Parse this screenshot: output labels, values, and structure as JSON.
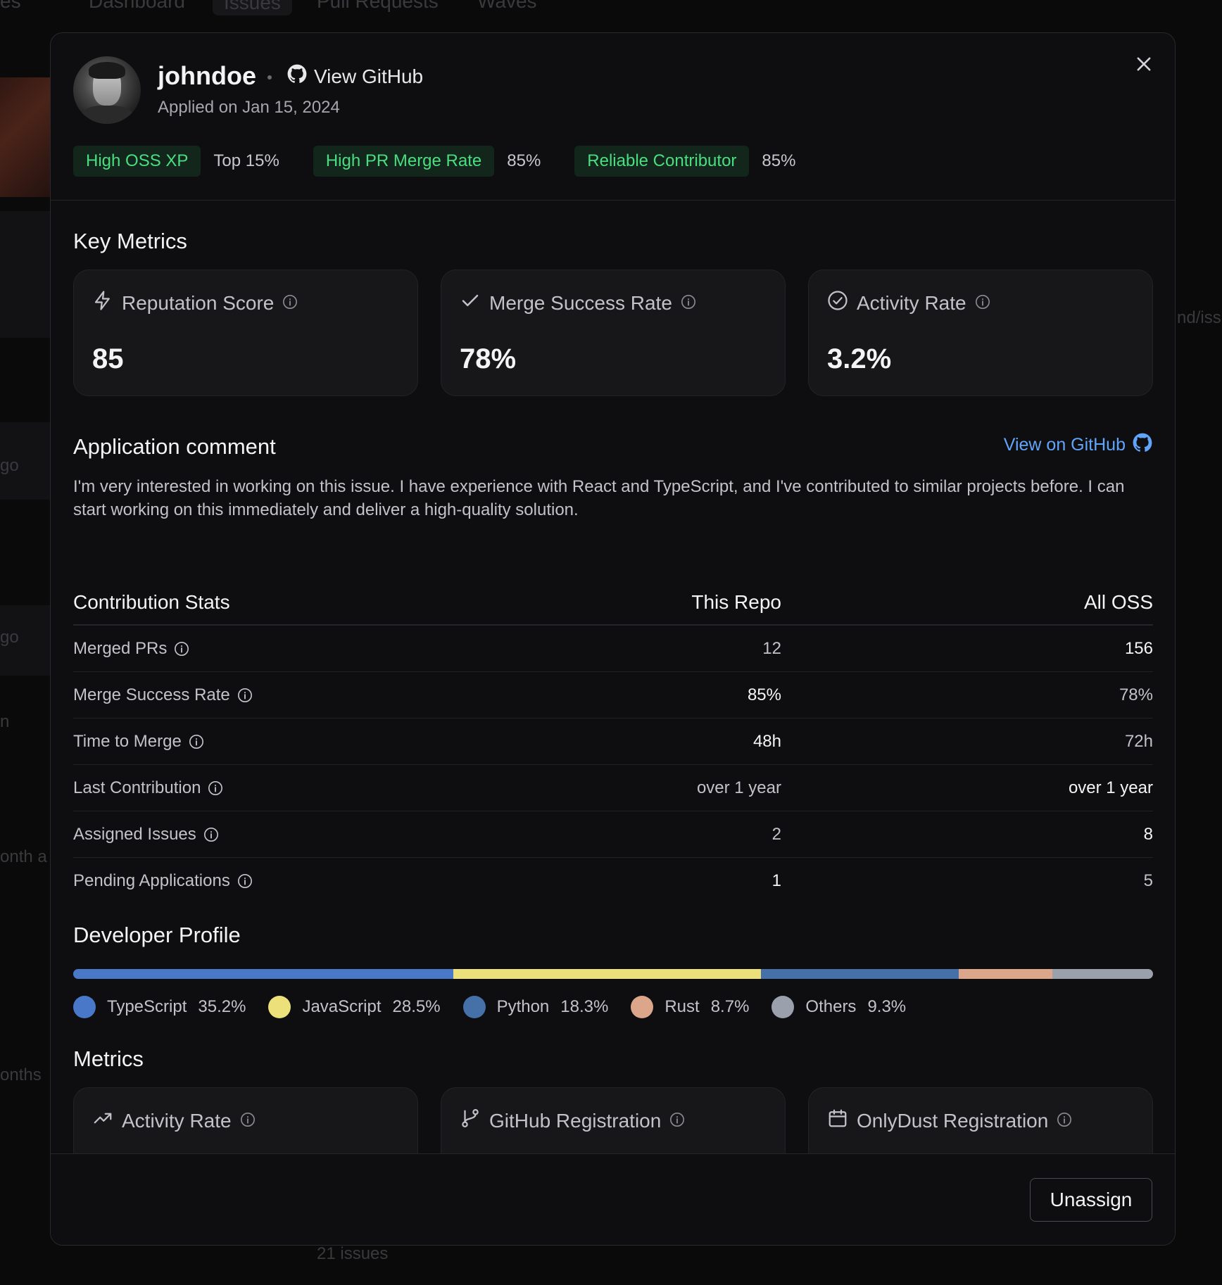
{
  "background": {
    "nav_tabs": [
      "es",
      "Dashboard",
      "Issues",
      "Pull Requests",
      "Waves"
    ],
    "fragments": [
      "nd/iss",
      "go",
      "go",
      "n",
      "onth a",
      "onths",
      "21 issues"
    ]
  },
  "header": {
    "username": "johndoe",
    "view_github_label": "View GitHub",
    "applied_text": "Applied on Jan 15, 2024",
    "badges": [
      {
        "label": "High OSS XP",
        "value": "Top 15%"
      },
      {
        "label": "High PR Merge Rate",
        "value": "85%"
      },
      {
        "label": "Reliable Contributor",
        "value": "85%"
      }
    ]
  },
  "key_metrics": {
    "title": "Key Metrics",
    "cards": [
      {
        "label": "Reputation Score",
        "value": "85",
        "icon": "lightning-icon"
      },
      {
        "label": "Merge Success Rate",
        "value": "78%",
        "icon": "check-icon"
      },
      {
        "label": "Activity Rate",
        "value": "3.2%",
        "icon": "check-circle-icon"
      }
    ]
  },
  "application_comment": {
    "title": "Application comment",
    "link_label": "View on GitHub",
    "text": "I'm very interested in working on this issue. I have experience with React and TypeScript, and I've contributed to similar projects before. I can start working on this immediately and deliver a high-quality solution."
  },
  "contribution_stats": {
    "headers": [
      "Contribution Stats",
      "This Repo",
      "All OSS"
    ],
    "rows": [
      {
        "label": "Merged PRs",
        "repo": "12",
        "all": "156"
      },
      {
        "label": "Merge Success Rate",
        "repo": "85%",
        "all": "78%"
      },
      {
        "label": "Time to Merge",
        "repo": "48h",
        "all": "72h"
      },
      {
        "label": "Last Contribution",
        "repo": "over 1 year",
        "all": "over 1 year"
      },
      {
        "label": "Assigned Issues",
        "repo": "2",
        "all": "8"
      },
      {
        "label": "Pending Applications",
        "repo": "1",
        "all": "5"
      }
    ]
  },
  "developer_profile": {
    "title": "Developer Profile",
    "languages": [
      {
        "name": "TypeScript",
        "pct": "35.2%",
        "share": 35.2,
        "color": "#4a78c8"
      },
      {
        "name": "JavaScript",
        "pct": "28.5%",
        "share": 28.5,
        "color": "#ece07a"
      },
      {
        "name": "Python",
        "pct": "18.3%",
        "share": 18.3,
        "color": "#4670a8"
      },
      {
        "name": "Rust",
        "pct": "8.7%",
        "share": 8.7,
        "color": "#dca68a"
      },
      {
        "name": "Others",
        "pct": "9.3%",
        "share": 9.3,
        "color": "#9aa0ac"
      }
    ]
  },
  "metrics": {
    "title": "Metrics",
    "cards": [
      {
        "label": "Activity Rate",
        "icon": "trending-up-icon"
      },
      {
        "label": "GitHub Registration",
        "icon": "git-branch-icon"
      },
      {
        "label": "OnlyDust Registration",
        "icon": "calendar-icon"
      }
    ]
  },
  "footer": {
    "unassign_label": "Unassign"
  }
}
